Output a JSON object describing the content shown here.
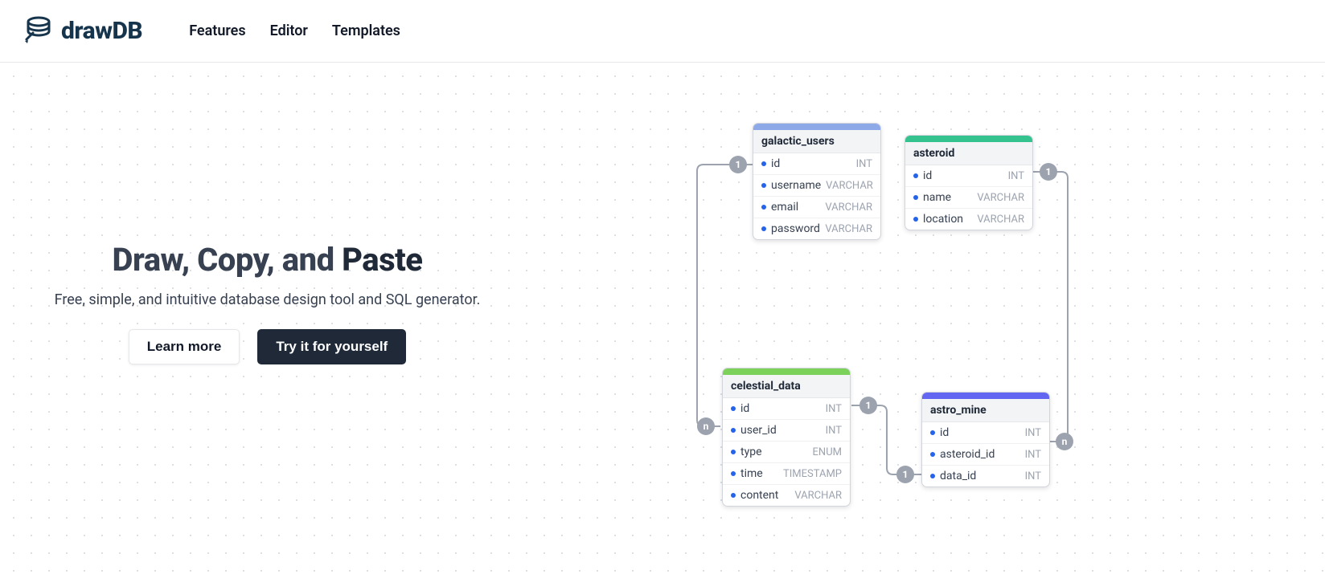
{
  "brand": {
    "name": "drawDB"
  },
  "nav": {
    "features": "Features",
    "editor": "Editor",
    "templates": "Templates"
  },
  "hero": {
    "headline_1": "Draw, Copy, and ",
    "headline_2": "Paste",
    "subhead": "Free, simple, and intuitive database design tool and SQL generator.",
    "learn_more": "Learn more",
    "try_it": "Try it for yourself"
  },
  "tables": {
    "galactic_users": {
      "name": "galactic_users",
      "color": "#8ea9e8",
      "fields": [
        {
          "name": "id",
          "type": "INT"
        },
        {
          "name": "username",
          "type": "VARCHAR"
        },
        {
          "name": "email",
          "type": "VARCHAR"
        },
        {
          "name": "password",
          "type": "VARCHAR"
        }
      ]
    },
    "asteroid": {
      "name": "asteroid",
      "color": "#34c38f",
      "fields": [
        {
          "name": "id",
          "type": "INT"
        },
        {
          "name": "name",
          "type": "VARCHAR"
        },
        {
          "name": "location",
          "type": "VARCHAR"
        }
      ]
    },
    "celestial_data": {
      "name": "celestial_data",
      "color": "#7cd15b",
      "fields": [
        {
          "name": "id",
          "type": "INT"
        },
        {
          "name": "user_id",
          "type": "INT"
        },
        {
          "name": "type",
          "type": "ENUM"
        },
        {
          "name": "time",
          "type": "TIMESTAMP"
        },
        {
          "name": "content",
          "type": "VARCHAR"
        }
      ]
    },
    "astro_mine": {
      "name": "astro_mine",
      "color": "#6366f1",
      "fields": [
        {
          "name": "id",
          "type": "INT"
        },
        {
          "name": "asteroid_id",
          "type": "INT"
        },
        {
          "name": "data_id",
          "type": "INT"
        }
      ]
    }
  },
  "relations": {
    "r1_from": "1",
    "r1_to": "n",
    "r2_from": "1",
    "r2_to": "n",
    "r3_from": "1",
    "r3_to": "1"
  }
}
